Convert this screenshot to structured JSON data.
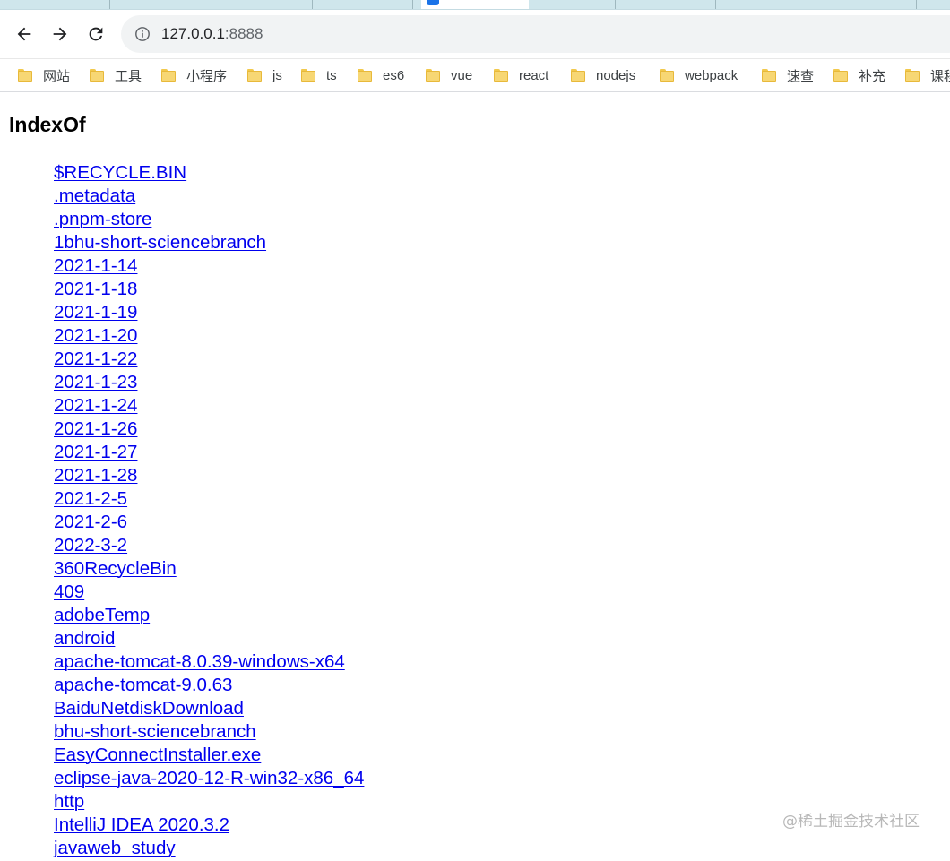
{
  "browser": {
    "address": {
      "host": "127.0.0.1",
      "port": ":8888"
    },
    "bookmarks": [
      "网站",
      "工具",
      "小程序",
      "js",
      "ts",
      "es6",
      "vue",
      "react",
      "nodejs",
      "webpack",
      "速查",
      "补充",
      "课程"
    ]
  },
  "page": {
    "title": "IndexOf",
    "entries": [
      "$RECYCLE.BIN",
      ".metadata",
      ".pnpm-store",
      "1bhu-short-sciencebranch",
      "2021-1-14",
      "2021-1-18",
      "2021-1-19",
      "2021-1-20",
      "2021-1-22",
      "2021-1-23",
      "2021-1-24",
      "2021-1-26",
      "2021-1-27",
      "2021-1-28",
      "2021-2-5",
      "2021-2-6",
      "2022-3-2",
      "360RecycleBin",
      "409",
      "adobeTemp",
      "android",
      "apache-tomcat-8.0.39-windows-x64",
      "apache-tomcat-9.0.63",
      "BaiduNetdiskDownload",
      "bhu-short-sciencebranch",
      "EasyConnectInstaller.exe",
      "eclipse-java-2020-12-R-win32-x86_64",
      "http",
      "IntelliJ IDEA 2020.3.2",
      "javaweb_study"
    ]
  },
  "watermark": "@稀土掘金技术社区"
}
